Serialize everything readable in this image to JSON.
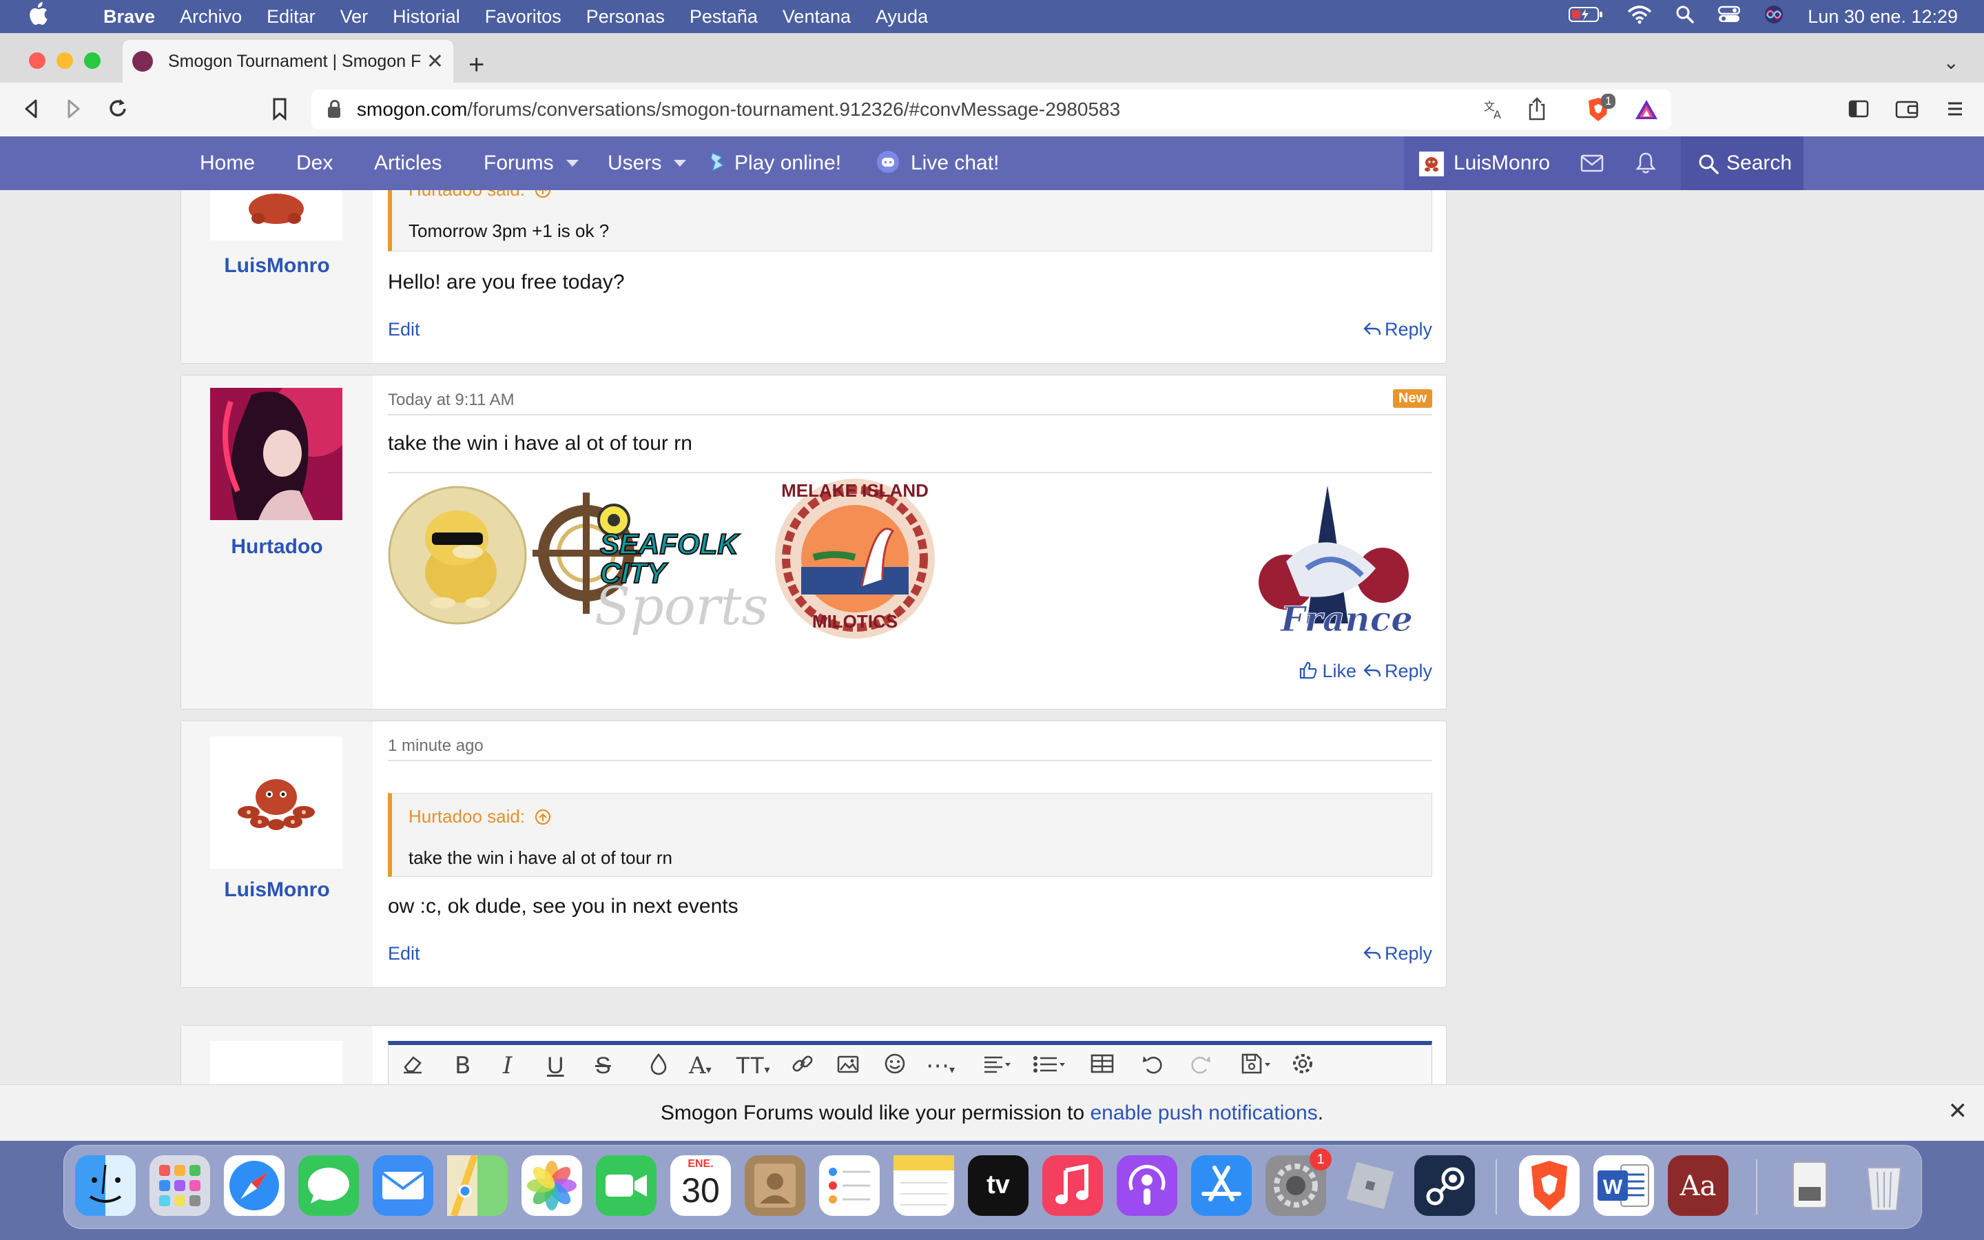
{
  "menubar": {
    "app": "Brave",
    "items": [
      "Archivo",
      "Editar",
      "Ver",
      "Historial",
      "Favoritos",
      "Personas",
      "Pestaña",
      "Ventana",
      "Ayuda"
    ],
    "clock": "Lun 30 ene.  12:29"
  },
  "browser": {
    "tab_title": "Smogon Tournament | Smogon F",
    "url_domain": "smogon.com",
    "url_path": "/forums/conversations/smogon-tournament.912326/#convMessage-2980583",
    "shields_badge": "1"
  },
  "site_nav": {
    "items": [
      "Home",
      "Dex",
      "Articles",
      "Forums",
      "Users",
      "Play online!",
      "Live chat!"
    ],
    "username": "LuisMonro",
    "search_label": "Search"
  },
  "messages": [
    {
      "user": "LuisMonro",
      "quote_author": "Hurtadoo said:",
      "quote_text": "Tomorrow 3pm +1 is ok ?",
      "text": "Hello! are you free today?",
      "edit_label": "Edit",
      "reply_label": "Reply"
    },
    {
      "user": "Hurtadoo",
      "time": "Today at 9:11 AM",
      "badge": "New",
      "text": "take the win i have al ot of tour rn",
      "signature": {
        "img2_text": "SEAFOLK CITY",
        "img2_script": "Sports",
        "img3_top": "MELAKE ISLAND",
        "img3_bottom": "MILOTICS",
        "img4_text": "France"
      },
      "like_label": "Like",
      "reply_label": "Reply"
    },
    {
      "user": "LuisMonro",
      "time": "1 minute ago",
      "quote_author": "Hurtadoo said:",
      "quote_text": "take the win i have al ot of tour rn",
      "text": "ow :c, ok dude, see you in next events",
      "edit_label": "Edit",
      "reply_label": "Reply"
    }
  ],
  "notification": {
    "prefix": "Smogon Forums would like your permission to ",
    "link": "enable push notifications",
    "suffix": "."
  },
  "dock": {
    "calendar_month": "ENE.",
    "calendar_day": "30",
    "settings_badge": "1",
    "tv_label": "tv",
    "word_label": "W",
    "dictionary_label": "Aa"
  }
}
